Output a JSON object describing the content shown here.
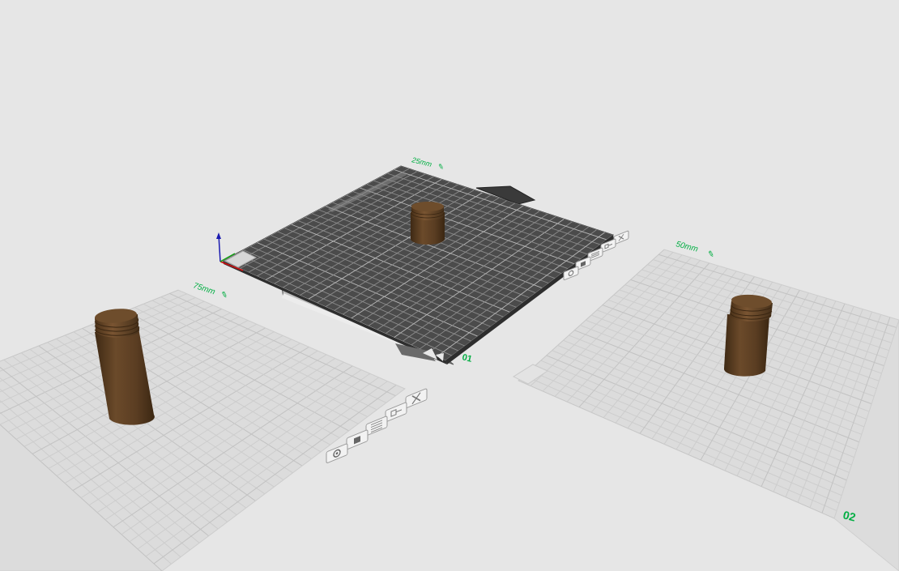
{
  "plates": {
    "center": {
      "height_label": "25mm",
      "plate_label": "01",
      "lock_icon": "pencil-icon",
      "tools": [
        "close-icon",
        "arrange-icon",
        "auto-orient-icon",
        "lock-icon",
        "settings-icon"
      ]
    },
    "left": {
      "height_label": "75mm",
      "plate_label": "",
      "lock_icon": "pencil-icon",
      "tools": [
        "close-icon",
        "arrange-icon",
        "auto-orient-icon",
        "lock-icon",
        "settings-icon"
      ]
    },
    "right": {
      "height_label": "50mm",
      "plate_label": "02",
      "lock_icon": "pencil-icon"
    }
  },
  "colors": {
    "background": "#e6e6e6",
    "accent_green": "#00ae42",
    "active_plate": "#4b4b4b",
    "inactive_plate": "#d9d9d9",
    "model": "#5a3d22"
  }
}
